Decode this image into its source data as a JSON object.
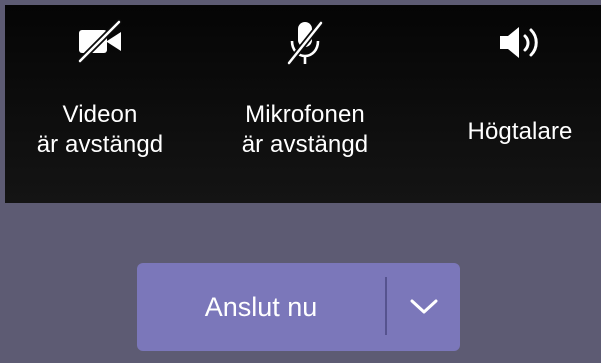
{
  "devices": {
    "video": {
      "label_line1": "Videon",
      "label_line2": "är avstängd",
      "icon": "video-off-icon"
    },
    "mic": {
      "label_line1": "Mikrofonen",
      "label_line2": "är avstängd",
      "icon": "microphone-off-icon"
    },
    "speaker": {
      "label": "Högtalare",
      "icon": "speaker-icon"
    }
  },
  "join": {
    "label": "Anslut nu",
    "dropdown_icon": "chevron-down-icon"
  },
  "colors": {
    "top_bar": "#0b0b0b",
    "background": "#5d5b73",
    "button": "#7b77ba",
    "text": "#ffffff"
  }
}
